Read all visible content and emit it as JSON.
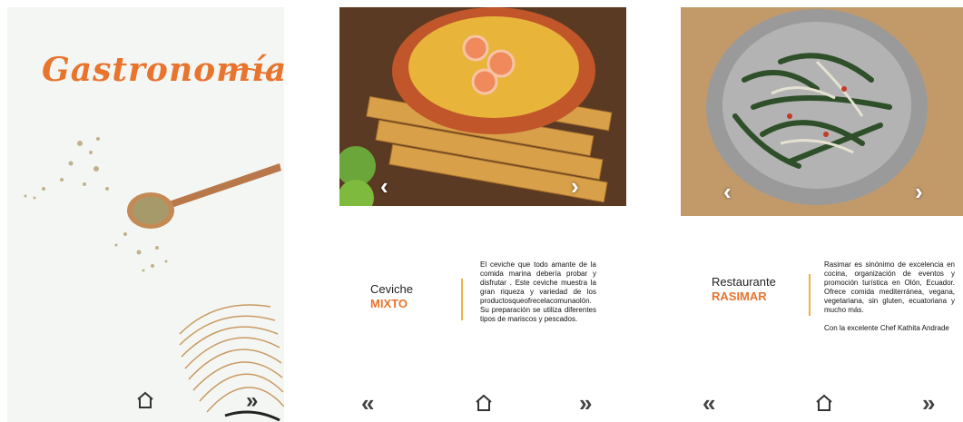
{
  "colors": {
    "accent": "#e8742e",
    "divider": "#f0b23b"
  },
  "cover": {
    "title": "Gastronomía",
    "home_icon": "home-icon",
    "next_icon": "double-chevron-right-icon",
    "next_label": "»"
  },
  "card1": {
    "name_line1": "Ceviche",
    "name_line2": "MIXTO",
    "description": "El ceviche que todo amante de la comida marina debería probar y disfrutar . Este ceviche muestra la gran riqueza y variedad de los productosqueofrecelacomunaolón. Su preparación se utiliza diferentes tipos de mariscos y pescados.",
    "prev_label": "‹",
    "next_label": "›",
    "nav_prev": "«",
    "nav_next": "»"
  },
  "card2": {
    "name_line1": "Restaurante",
    "name_line2": "RASIMAR",
    "description": "Rasimar es sinónimo de excelencia en cocina, organización de eventos y promoción turística en Olón, Ecuador. Ofrece comida mediterránea, vegana, vegetariana, sin gluten, ecuatoriana y mucho más.",
    "description2": "Con la excelente Chef Kathita Andrade",
    "prev_label": "‹",
    "next_label": "›",
    "nav_prev": "«",
    "nav_next": "»"
  }
}
